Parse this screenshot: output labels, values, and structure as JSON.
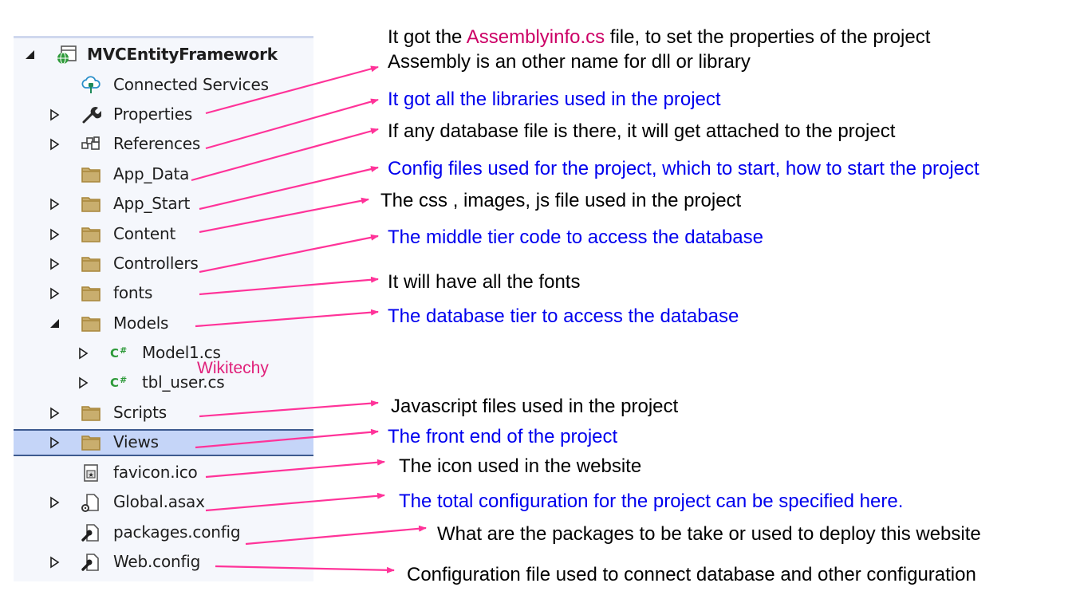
{
  "tree": {
    "root": {
      "label": "MVCEntityFramework",
      "icon": "web-project-icon",
      "expanded": true
    },
    "items": [
      {
        "label": "Connected Services",
        "icon": "connected-services-icon",
        "expander": "none",
        "depth": 1
      },
      {
        "label": "Properties",
        "icon": "wrench-icon",
        "expander": "collapsed",
        "depth": 1
      },
      {
        "label": "References",
        "icon": "references-icon",
        "expander": "collapsed",
        "depth": 1
      },
      {
        "label": "App_Data",
        "icon": "folder-icon",
        "expander": "none",
        "depth": 1
      },
      {
        "label": "App_Start",
        "icon": "folder-icon",
        "expander": "collapsed",
        "depth": 1
      },
      {
        "label": "Content",
        "icon": "folder-icon",
        "expander": "collapsed",
        "depth": 1
      },
      {
        "label": "Controllers",
        "icon": "folder-icon",
        "expander": "collapsed",
        "depth": 1
      },
      {
        "label": "fonts",
        "icon": "folder-icon",
        "expander": "collapsed",
        "depth": 1
      },
      {
        "label": "Models",
        "icon": "folder-icon",
        "expander": "expanded",
        "depth": 1
      },
      {
        "label": "Model1.cs",
        "icon": "csharp-icon",
        "expander": "collapsed",
        "depth": 2
      },
      {
        "label": "tbl_user.cs",
        "icon": "csharp-icon",
        "expander": "collapsed",
        "depth": 2
      },
      {
        "label": "Scripts",
        "icon": "folder-icon",
        "expander": "collapsed",
        "depth": 1
      },
      {
        "label": "Views",
        "icon": "folder-icon",
        "expander": "collapsed",
        "depth": 1,
        "selected": true
      },
      {
        "label": "favicon.ico",
        "icon": "favicon-file-icon",
        "expander": "none",
        "depth": 1
      },
      {
        "label": "Global.asax",
        "icon": "asax-file-icon",
        "expander": "collapsed",
        "depth": 1
      },
      {
        "label": "packages.config",
        "icon": "config-file-icon",
        "expander": "none",
        "depth": 1
      },
      {
        "label": "Web.config",
        "icon": "config-file-icon",
        "expander": "collapsed",
        "depth": 1
      }
    ],
    "csharp_glyph": "C#"
  },
  "watermark": "Wikitechy",
  "annotations": {
    "properties_line1_pre": "It got the ",
    "properties_line1_highlight": "Assemblyinfo.cs",
    "properties_line1_post": " file, to set the properties of the project",
    "properties_line2": "Assembly is an other name for dll or library",
    "references": "It got all the libraries used in the project",
    "app_data": "If any database file is there, it will get attached to the project",
    "app_start": "Config files used for the project, which to start, how to start the project",
    "content": "The css , images, js file used in the project",
    "controllers": "The middle tier code to access the database",
    "fonts": "It will have all the fonts",
    "models": "The database tier to access the database",
    "scripts": "Javascript files used in the project",
    "views": "The front end of the project",
    "favicon": "The icon used in the website",
    "global": "The total configuration for the project can be specified here.",
    "packages": "What are the packages to be take or used to deploy this website",
    "webconfig": "Configuration file used to connect database and other configuration"
  },
  "colors": {
    "arrow": "#ff3399",
    "note_black": "#000000",
    "note_blue": "#0000ee",
    "highlight": "#cc0066",
    "selection": "#c5d5f8",
    "panel": "#f5f7fc",
    "folder": "#c9ae6e"
  }
}
